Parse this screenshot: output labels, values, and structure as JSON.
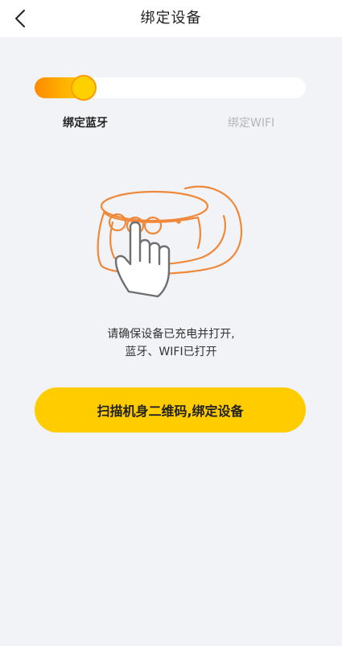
{
  "header": {
    "title": "绑定设备",
    "back_icon": "chevron-left-icon"
  },
  "progress": {
    "fraction": 0.18,
    "fill_color_start": "#ff8a00",
    "fill_color_end": "#ffcc00",
    "track_color": "#ffffff"
  },
  "steps": [
    {
      "label": "绑定蓝牙",
      "active": true
    },
    {
      "label": "绑定WIFI",
      "active": false
    }
  ],
  "illustration": {
    "icon": "hand-press-device-icon",
    "accent_color": "#f0883a"
  },
  "hint": {
    "line1": "请确保设备已充电并打开,",
    "line2": "蓝牙、WIFI已打开"
  },
  "scan_button": {
    "label": "扫描机身二维码,绑定设备",
    "color": "#ffcc00"
  }
}
